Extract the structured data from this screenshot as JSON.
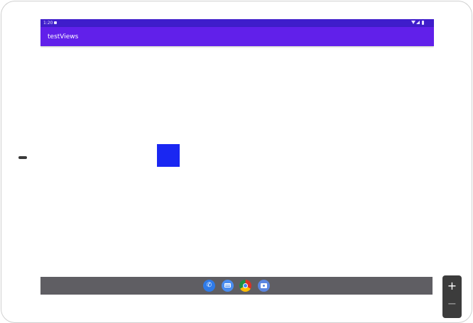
{
  "status_bar": {
    "time": "1:20",
    "icons": [
      "notification-icon",
      "wifi-icon",
      "signal-icon",
      "battery-icon"
    ]
  },
  "app_bar": {
    "title": "testViews",
    "color": "#6120ea"
  },
  "content": {
    "square_color": "#1a27f2"
  },
  "nav_bar": {
    "dock_icons": [
      "phone-icon",
      "messages-icon",
      "chrome-icon",
      "camera-icon"
    ]
  },
  "zoom_control": {
    "zoom_in": "+",
    "zoom_out": "−"
  }
}
